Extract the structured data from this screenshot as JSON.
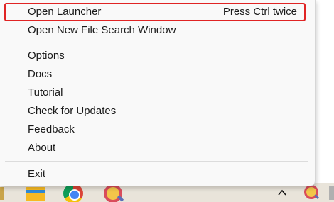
{
  "menu": {
    "items": [
      {
        "label": "Open Launcher",
        "shortcut": "Press Ctrl twice"
      },
      {
        "label": "Open New File Search Window"
      },
      {
        "label": "Options"
      },
      {
        "label": "Docs"
      },
      {
        "label": "Tutorial"
      },
      {
        "label": "Check for Updates"
      },
      {
        "label": "Feedback"
      },
      {
        "label": "About"
      },
      {
        "label": "Exit"
      }
    ]
  },
  "taskbar": {
    "icons": [
      "folder-icon",
      "chrome-icon",
      "search-app-icon",
      "chevron-up-icon",
      "tray-search-icon"
    ],
    "chevron": "^"
  },
  "colors": {
    "highlight_border": "#e02424",
    "menu_background": "#f9f9f9",
    "taskbar_background": "#e9e4da"
  }
}
